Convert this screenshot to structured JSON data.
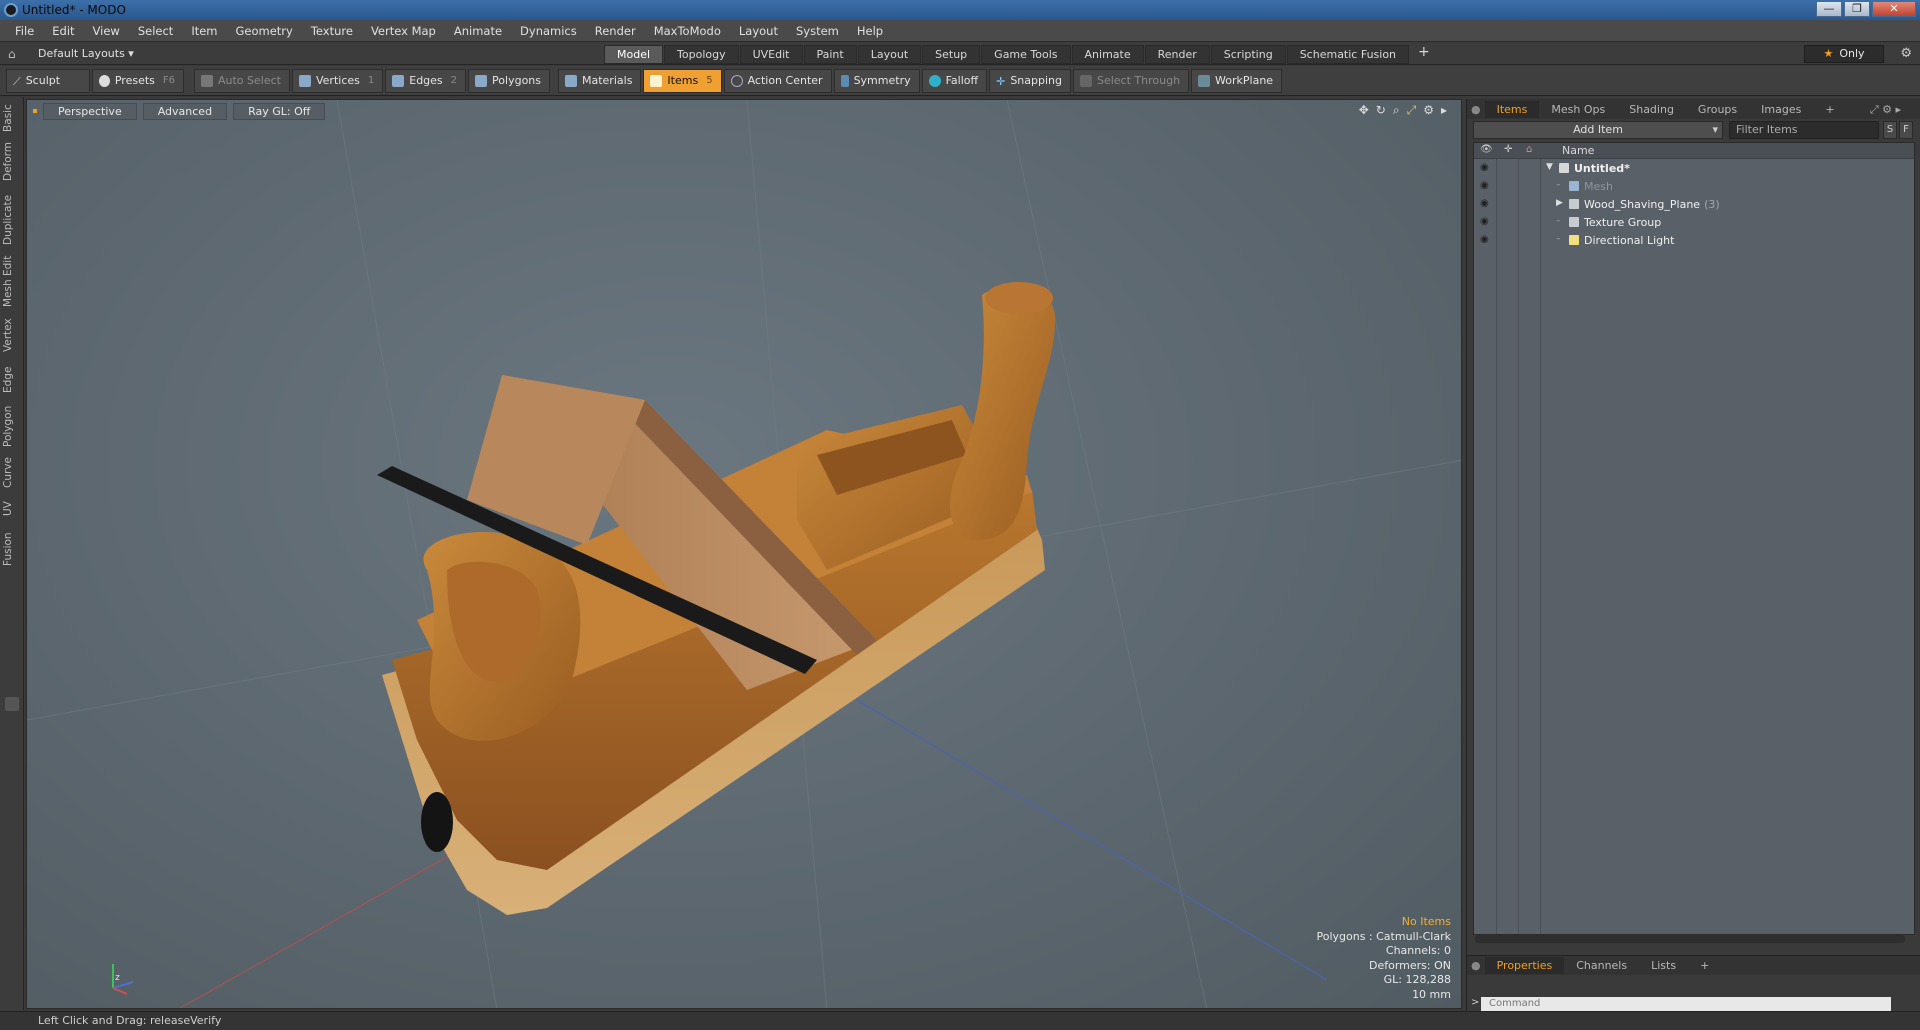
{
  "window": {
    "title": "Untitled* - MODO",
    "minimize": "—",
    "maximize": "❐",
    "close": "✕"
  },
  "menu": [
    "File",
    "Edit",
    "View",
    "Select",
    "Item",
    "Geometry",
    "Texture",
    "Vertex Map",
    "Animate",
    "Dynamics",
    "Render",
    "MaxToModo",
    "Layout",
    "System",
    "Help"
  ],
  "layoutbar": {
    "layout_label": "Default Layouts ▾",
    "tabs": [
      "Model",
      "Topology",
      "UVEdit",
      "Paint",
      "Layout",
      "Setup",
      "Game Tools",
      "Animate",
      "Render",
      "Scripting",
      "Schematic Fusion"
    ],
    "active_tab": "Model",
    "plus": "+",
    "only_label": "Only"
  },
  "toolbar": {
    "sculpt": "Sculpt",
    "presets": "Presets",
    "presets_key": "F6",
    "auto_select": "Auto Select",
    "vertices": "Vertices",
    "vertices_key": "1",
    "edges": "Edges",
    "edges_key": "2",
    "polygons": "Polygons",
    "materials": "Materials",
    "items": "Items",
    "items_key": "5",
    "action_center": "Action Center",
    "symmetry": "Symmetry",
    "falloff": "Falloff",
    "snapping": "Snapping",
    "select_through": "Select Through",
    "workplane": "WorkPlane"
  },
  "left_tabs": [
    "Basic",
    "Deform",
    "Duplicate",
    "Mesh Edit",
    "Vertex",
    "Edge",
    "Polygon",
    "Curve",
    "UV",
    "Fusion"
  ],
  "viewport": {
    "view": "Perspective",
    "advanced": "Advanced",
    "raygl": "Ray GL: Off",
    "hud": {
      "no_items": "No Items",
      "polygons": "Polygons : Catmull-Clark",
      "channels": "Channels: 0",
      "deformers": "Deformers: ON",
      "gl": "GL: 128,288",
      "scale": "10 mm"
    }
  },
  "status": {
    "text": "Left Click and Drag:   releaseVerify"
  },
  "items_panel": {
    "tabs": [
      "Items",
      "Mesh Ops",
      "Shading",
      "Groups",
      "Images"
    ],
    "active_tab": "Items",
    "add_item": "Add Item",
    "filter_placeholder": "Filter Items",
    "s_btn": "S",
    "f_btn": "F",
    "column_name": "Name",
    "rows": [
      {
        "label": "Untitled*",
        "count": ""
      },
      {
        "label": "Mesh",
        "count": ""
      },
      {
        "label": "Wood_Shaving_Plane",
        "count": "(3)"
      },
      {
        "label": "Texture Group",
        "count": ""
      },
      {
        "label": "Directional Light",
        "count": ""
      }
    ]
  },
  "props_panel": {
    "tabs": [
      "Properties",
      "Channels",
      "Lists"
    ],
    "active_tab": "Properties",
    "command_placeholder": "Command",
    "prompt": ">"
  },
  "colors": {
    "accent": "#f0a020",
    "viewport_bg": "#5f6a72",
    "wood": "#b0712c"
  }
}
